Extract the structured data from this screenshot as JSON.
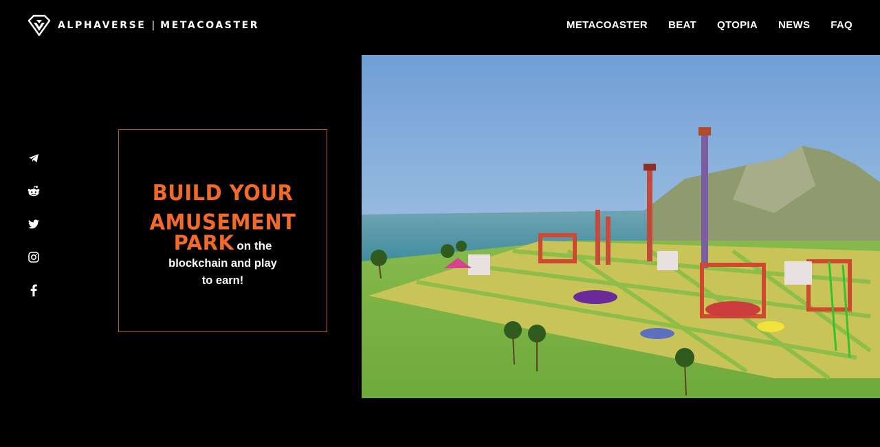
{
  "header": {
    "brand_name": "ALPHAVERSE",
    "brand_separator": "|",
    "brand_product": "METACOASTER",
    "logo_icon": "diamond-logo-icon"
  },
  "nav": {
    "items": [
      {
        "label": "METACOASTER"
      },
      {
        "label": "BEAT"
      },
      {
        "label": "QTOPIA"
      },
      {
        "label": "NEWS"
      },
      {
        "label": "FAQ"
      }
    ]
  },
  "social": {
    "icons": [
      "telegram-icon",
      "reddit-icon",
      "twitter-icon",
      "instagram-icon",
      "facebook-icon"
    ]
  },
  "hero": {
    "headline_line1": "BUILD YOUR",
    "headline_line2": "AMUSEMENT",
    "headline_park": "PARK",
    "sub_line1": "on the",
    "sub_line2": "blockchain and play",
    "sub_line3": "to earn!"
  },
  "colors": {
    "background": "#000000",
    "accent_orange": "#f36a28",
    "box_border": "#c4552b",
    "text": "#ffffff"
  }
}
